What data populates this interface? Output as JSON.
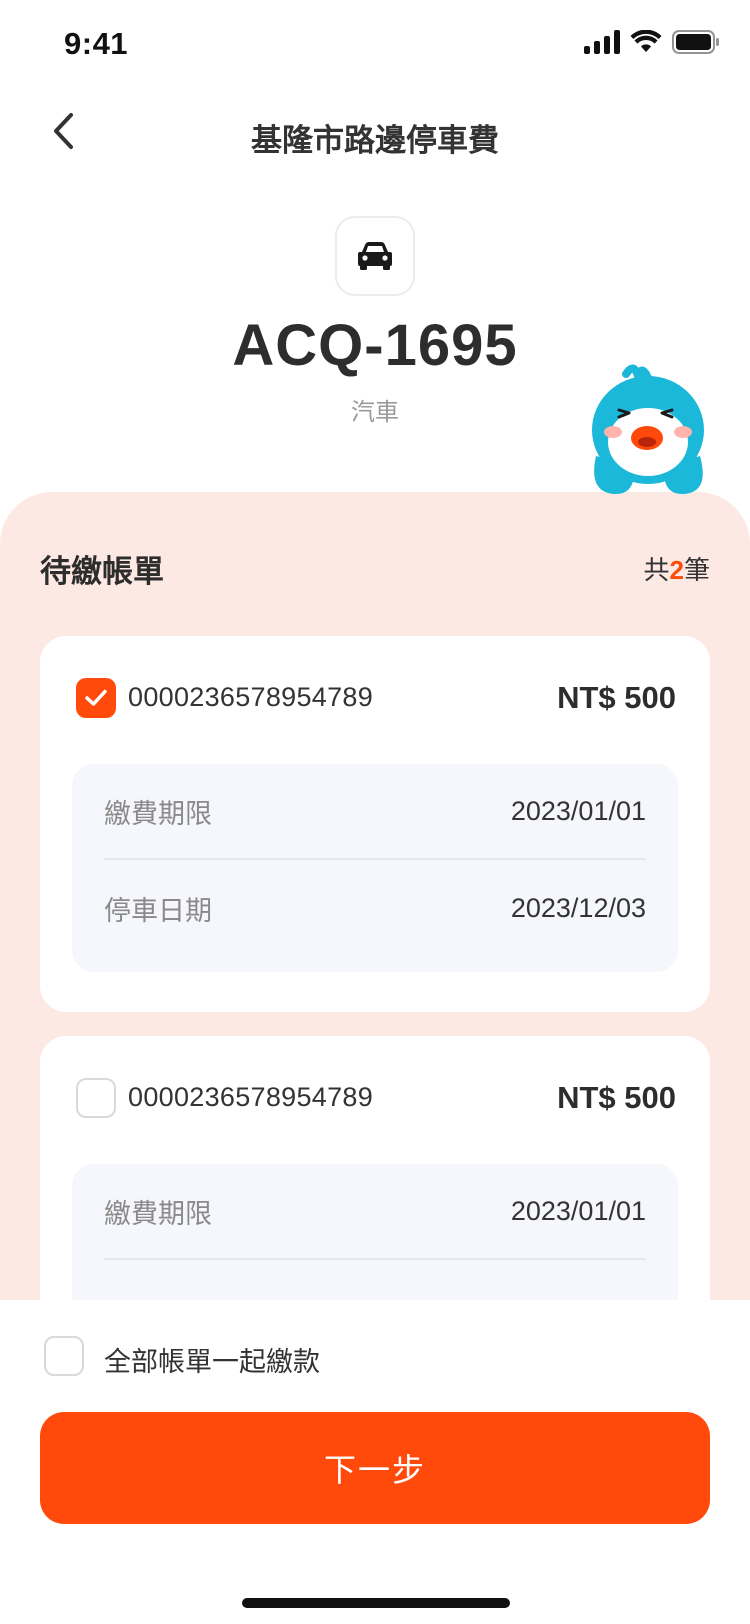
{
  "status_bar": {
    "time": "9:41"
  },
  "nav": {
    "title": "基隆市路邊停車費",
    "back_icon": "chevron-left-icon"
  },
  "vehicle": {
    "plate": "ACQ-1695",
    "type": "汽車",
    "icon": "car-icon"
  },
  "bills": {
    "title": "待繳帳單",
    "count_prefix": "共",
    "count": "2",
    "count_suffix": "筆",
    "items": [
      {
        "checked": true,
        "number": "0000236578954789",
        "amount": "NT$ 500",
        "due_label": "繳費期限",
        "due_value": "2023/01/01",
        "park_label": "停車日期",
        "park_value": "2023/12/03"
      },
      {
        "checked": false,
        "number": "0000236578954789",
        "amount": "NT$ 500",
        "due_label": "繳費期限",
        "due_value": "2023/01/01"
      }
    ]
  },
  "footer": {
    "pay_all_label": "全部帳單一起繳款",
    "next_label": "下一步"
  },
  "colors": {
    "accent": "#ff4a0c",
    "sheet_bg": "#fde9e3",
    "detail_bg": "#f5f7fc",
    "mascot": "#1bb8d9"
  }
}
